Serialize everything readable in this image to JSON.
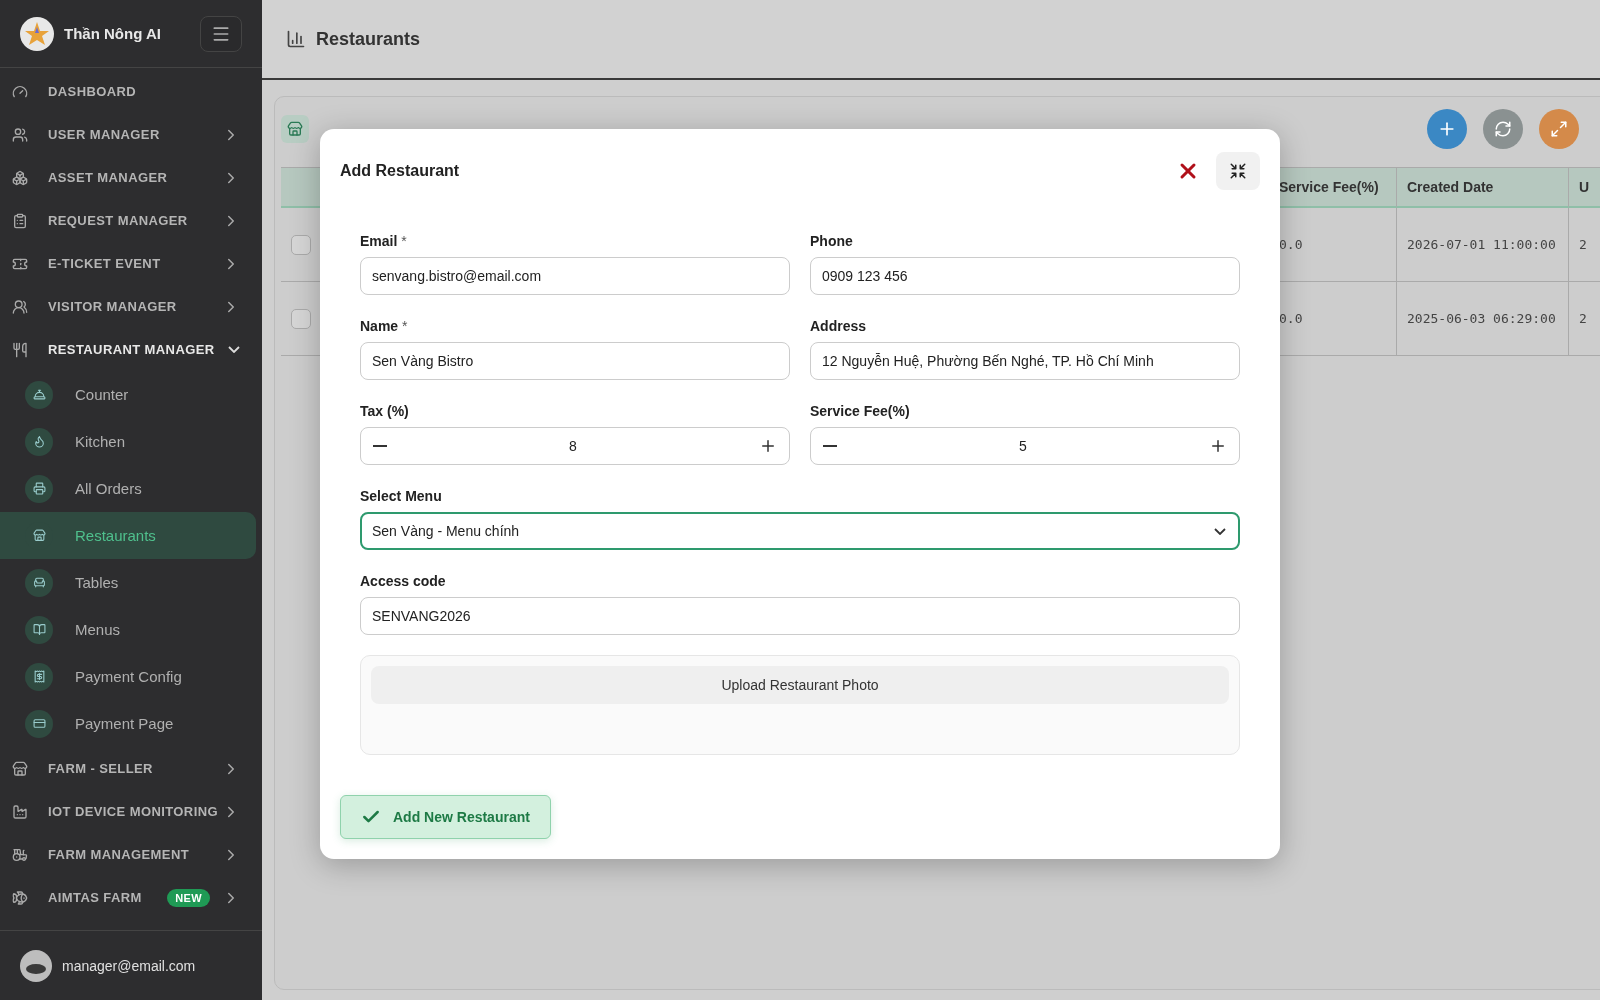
{
  "brand": {
    "name": "Thần Nông AI"
  },
  "sidebar": {
    "items": [
      {
        "label": "DASHBOARD"
      },
      {
        "label": "USER MANAGER",
        "expanded": false
      },
      {
        "label": "ASSET MANAGER",
        "expanded": false
      },
      {
        "label": "REQUEST MANAGER",
        "expanded": false
      },
      {
        "label": "E-TICKET EVENT",
        "expanded": false
      },
      {
        "label": "VISITOR MANAGER",
        "expanded": false
      },
      {
        "label": "RESTAURANT MANAGER",
        "expanded": true,
        "children": [
          {
            "label": "Counter",
            "selected": false
          },
          {
            "label": "Kitchen",
            "selected": false
          },
          {
            "label": "All Orders",
            "selected": false
          },
          {
            "label": "Restaurants",
            "selected": true
          },
          {
            "label": "Tables",
            "selected": false
          },
          {
            "label": "Menus",
            "selected": false
          },
          {
            "label": "Payment Config",
            "selected": false
          },
          {
            "label": "Payment Page",
            "selected": false
          }
        ]
      },
      {
        "label": "FARM - SELLER",
        "expanded": false
      },
      {
        "label": "IOT DEVICE MONITORING",
        "expanded": false
      },
      {
        "label": "FARM MANAGEMENT",
        "expanded": false
      },
      {
        "label": "AIMTAS FARM",
        "expanded": false,
        "badge": "NEW"
      }
    ]
  },
  "user": {
    "email": "manager@email.com"
  },
  "page": {
    "title": "Restaurants"
  },
  "table": {
    "columns": [
      "Service Fee(%)",
      "Created Date",
      "U"
    ],
    "rows": [
      {
        "checked": false,
        "cells": [
          "0.0",
          "2026-07-01 11:00:00",
          "2"
        ]
      },
      {
        "checked": false,
        "cells": [
          "0.0",
          "2025-06-03 06:29:00",
          "2"
        ]
      }
    ]
  },
  "modal": {
    "title": "Add Restaurant",
    "fields": [
      {
        "kind": "text",
        "label": "Email",
        "required_mark": "*",
        "value": "senvang.bistro@email.com"
      },
      {
        "kind": "text",
        "label": "Phone",
        "value": "0909 123 456"
      },
      {
        "kind": "text",
        "label": "Name",
        "required_mark": "*",
        "value": "Sen Vàng Bistro"
      },
      {
        "kind": "text",
        "label": "Address",
        "value": "12 Nguyễn Huệ, Phường Bến Nghé, TP. Hồ Chí Minh"
      },
      {
        "kind": "stepper",
        "label": "Tax (%)",
        "value": "8"
      },
      {
        "kind": "stepper",
        "label": "Service Fee(%)",
        "value": "5"
      },
      {
        "kind": "select",
        "label": "Select Menu",
        "value": "Sen Vàng - Menu chính",
        "focused": true
      },
      {
        "kind": "text",
        "label": "Access code",
        "value": "SENVANG2026"
      }
    ],
    "upload": {
      "label": "Upload Restaurant Photo"
    },
    "submit": {
      "label": "Add New Restaurant"
    }
  }
}
